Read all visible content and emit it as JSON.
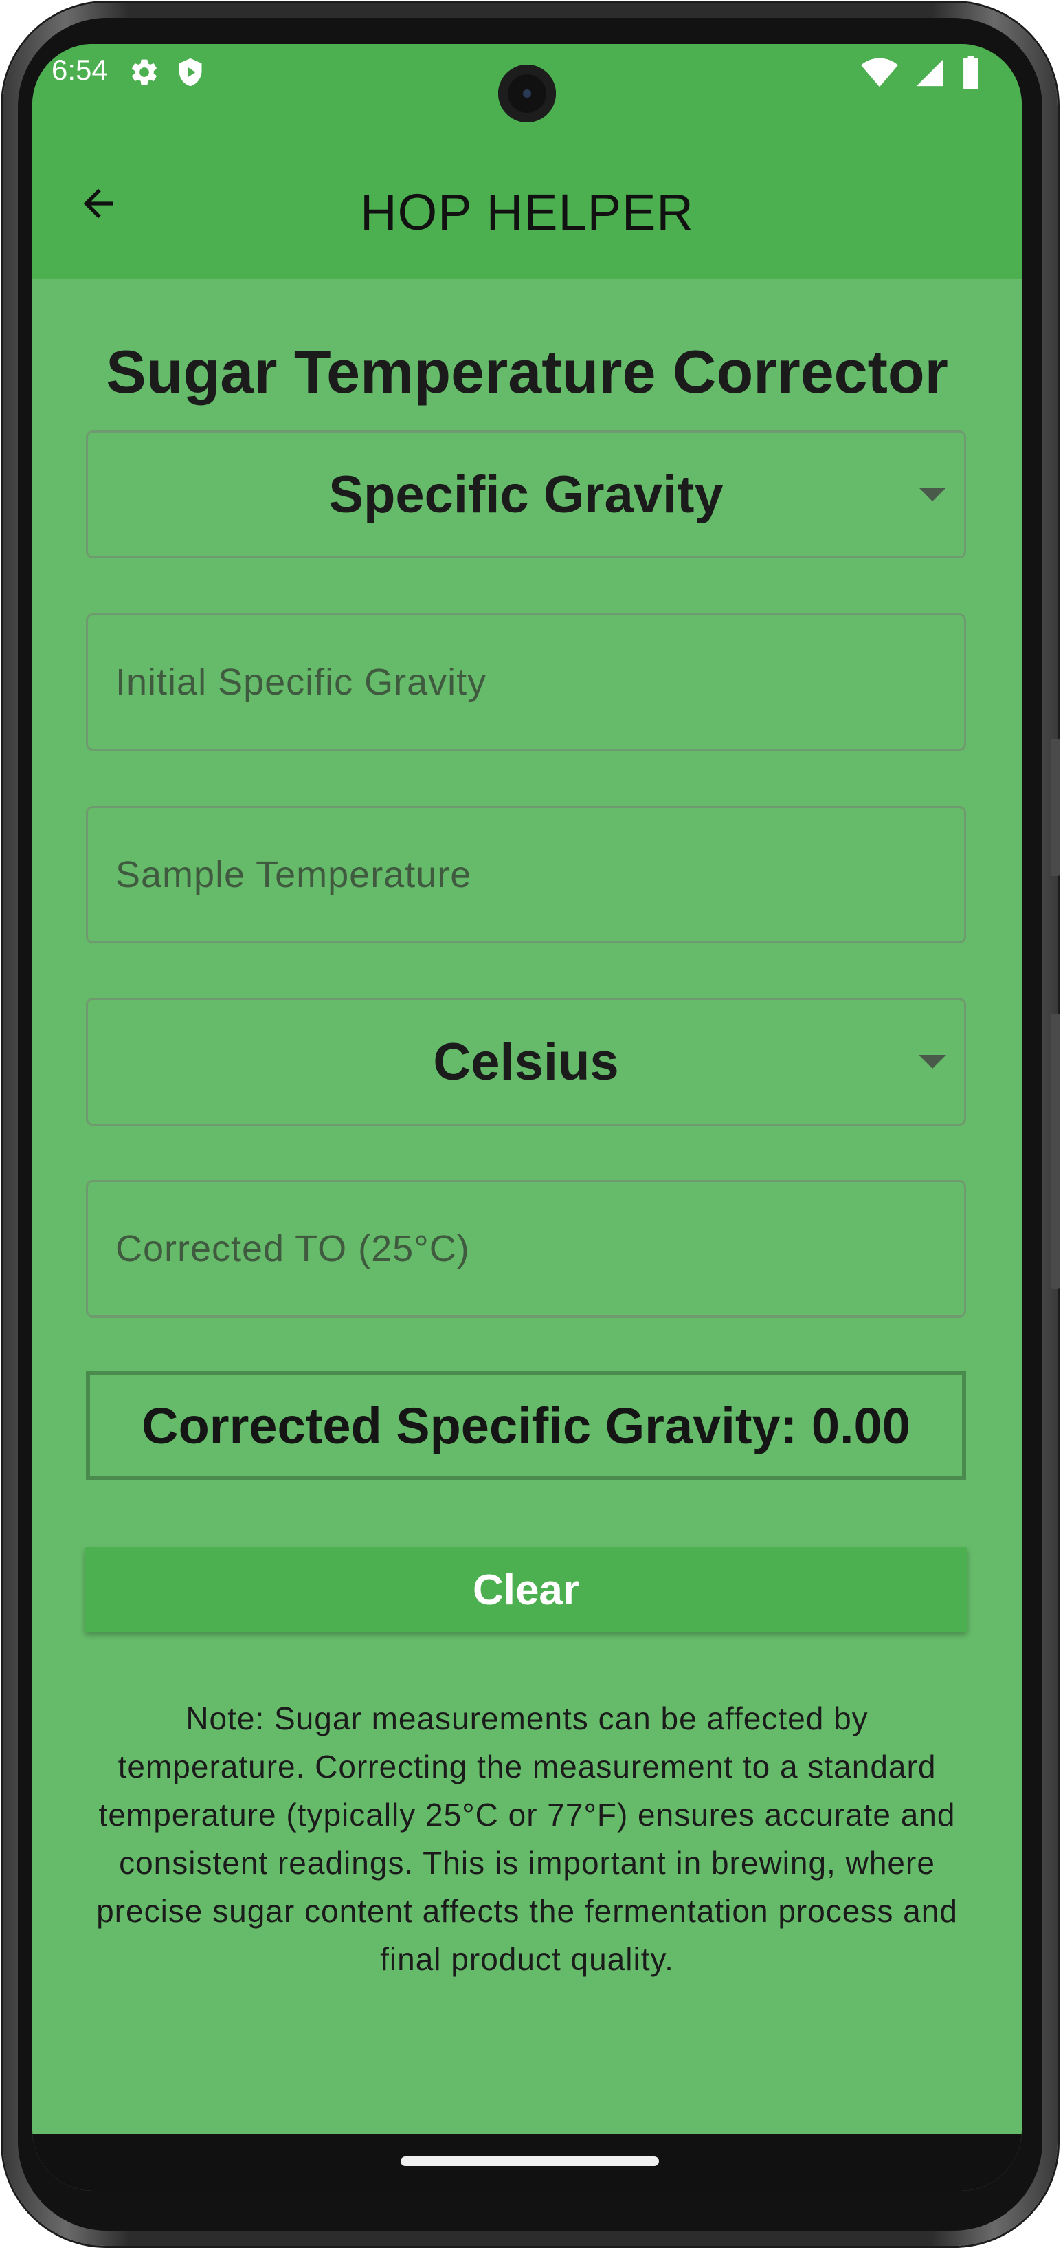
{
  "status_bar": {
    "time": "6:54",
    "icons_left": [
      "settings-gear-icon",
      "shield-icon"
    ],
    "icons_right": [
      "wifi-icon",
      "cellular-signal-icon",
      "battery-icon"
    ]
  },
  "app_bar": {
    "title": "HOP HELPER",
    "back_icon": "arrow-left-icon",
    "color": "#4caf50"
  },
  "page": {
    "title": "Sugar Temperature Corrector",
    "background": "#66bb6a"
  },
  "form": {
    "measurement_type": {
      "selected": "Specific Gravity"
    },
    "initial_value": {
      "placeholder": "Initial Specific Gravity",
      "value": ""
    },
    "sample_temperature": {
      "placeholder": "Sample Temperature",
      "value": ""
    },
    "temperature_unit": {
      "selected": "Celsius"
    },
    "corrected_to": {
      "placeholder": "Corrected TO (25°C)",
      "value": ""
    }
  },
  "result": {
    "label": "Corrected Specific Gravity: 0.00"
  },
  "actions": {
    "clear_label": "Clear"
  },
  "note": "Note: Sugar measurements can be affected by temperature. Correcting the measurement to a standard temperature (typically 25°C or 77°F) ensures accurate and consistent readings. This is important in brewing, where precise sugar content affects the fermentation process and final product quality."
}
